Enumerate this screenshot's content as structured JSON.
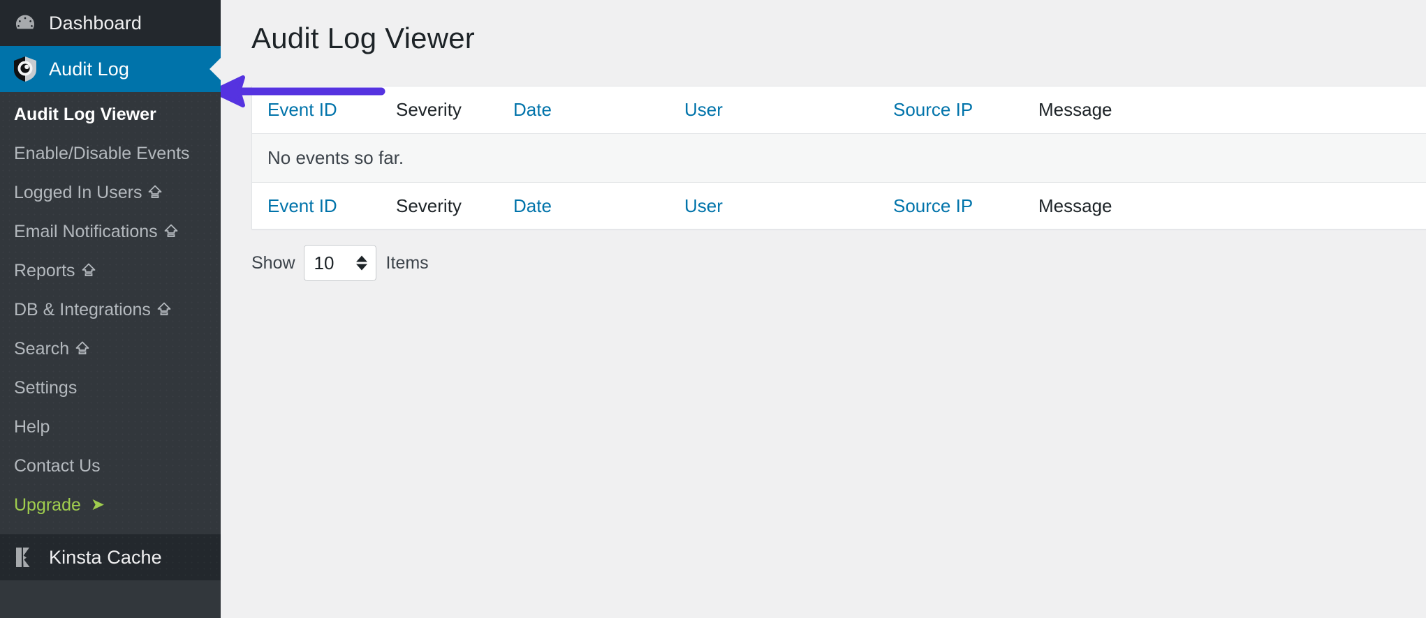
{
  "sidebar": {
    "top_items": [
      {
        "label": "Dashboard",
        "icon": "dashboard-gauge-icon",
        "active": false
      },
      {
        "label": "Audit Log",
        "icon": "audit-log-shield-icon",
        "active": true
      }
    ],
    "submenu": [
      {
        "label": "Audit Log Viewer",
        "current": true,
        "upgrade_badge": false
      },
      {
        "label": "Enable/Disable Events",
        "current": false,
        "upgrade_badge": false
      },
      {
        "label": "Logged In Users",
        "current": false,
        "upgrade_badge": true
      },
      {
        "label": "Email Notifications",
        "current": false,
        "upgrade_badge": true
      },
      {
        "label": "Reports",
        "current": false,
        "upgrade_badge": true
      },
      {
        "label": "DB & Integrations",
        "current": false,
        "upgrade_badge": true
      },
      {
        "label": "Search",
        "current": false,
        "upgrade_badge": true
      },
      {
        "label": "Settings",
        "current": false,
        "upgrade_badge": false
      },
      {
        "label": "Help",
        "current": false,
        "upgrade_badge": false
      },
      {
        "label": "Contact Us",
        "current": false,
        "upgrade_badge": false
      }
    ],
    "upgrade": {
      "label": "Upgrade",
      "arrow": "➤"
    },
    "bottom_item": {
      "label": "Kinsta Cache",
      "icon": "kinsta-k-logo-icon"
    }
  },
  "main": {
    "page_title": "Audit Log Viewer",
    "annotation": {
      "type": "left-arrow",
      "color": "#5533e0"
    },
    "table": {
      "columns": [
        {
          "label": "Event ID",
          "link": true
        },
        {
          "label": "Severity",
          "link": false
        },
        {
          "label": "Date",
          "link": true
        },
        {
          "label": "User",
          "link": true
        },
        {
          "label": "Source IP",
          "link": true
        },
        {
          "label": "Message",
          "link": false
        }
      ],
      "empty_message": "No events so far."
    },
    "pagination": {
      "show_label": "Show",
      "items_label": "Items",
      "count_value": "10"
    }
  },
  "colors": {
    "sidebar_bg": "#32373c",
    "sidebar_top_bg": "#23282d",
    "active_blue": "#0073aa",
    "link_blue": "#0073aa",
    "upgrade_green": "#a0ce4e",
    "annotation_purple": "#5533e0",
    "content_bg": "#f0f0f1"
  }
}
